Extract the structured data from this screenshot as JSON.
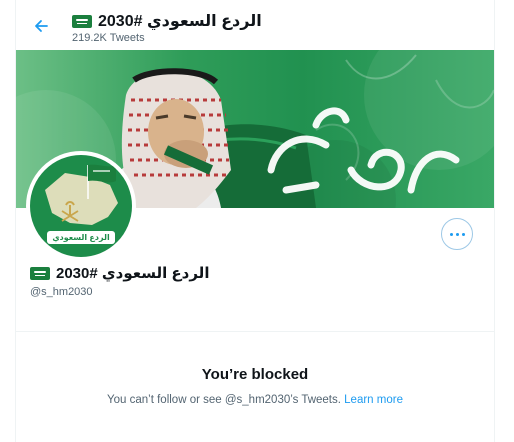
{
  "header": {
    "name": "الردع السعودي #2030",
    "tweet_count": "219.2K Tweets"
  },
  "banner": {
    "calligraphy_text": "وطن الفخر"
  },
  "avatar": {
    "label": "الردع السعودي"
  },
  "profile": {
    "name": "الردع السعودي #2030",
    "handle": "@s_hm2030"
  },
  "blocked": {
    "title": "You’re blocked",
    "message": "You can’t follow or see @s_hm2030’s Tweets.",
    "learn_more": "Learn more"
  },
  "colors": {
    "accent": "#1d9bf0",
    "text_primary": "#0f1419",
    "text_secondary": "#536471",
    "flag_green": "#1b7f3e",
    "banner_green": "#219150"
  },
  "icons": [
    "back-arrow-icon",
    "saudi-flag-icon",
    "more-options-icon"
  ]
}
